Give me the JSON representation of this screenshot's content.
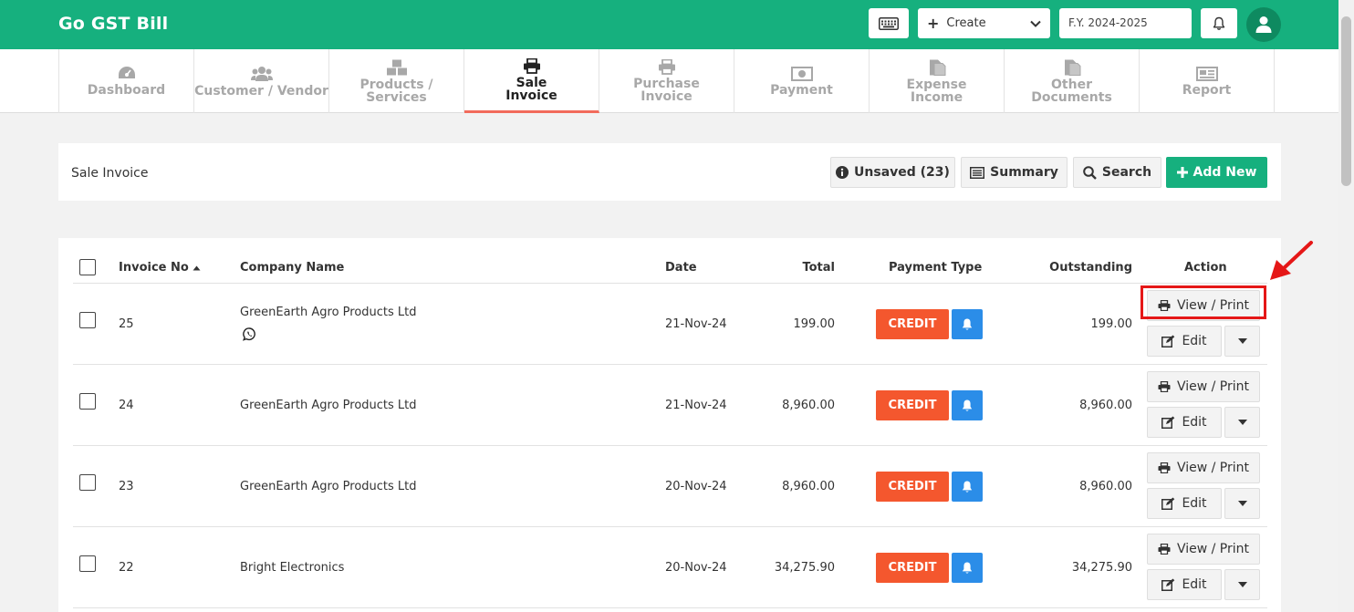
{
  "app": {
    "title": "Go GST Bill"
  },
  "topbar": {
    "keyboard_icon": "keyboard-icon",
    "create_label": "Create",
    "fy_value": "F.Y. 2024-2025",
    "notifications_icon": "bell-icon",
    "user_icon": "user-icon"
  },
  "nav": {
    "tabs": [
      {
        "label": "Dashboard",
        "icon": "dashboard-icon"
      },
      {
        "label": "Customer / Vendor",
        "icon": "users-icon"
      },
      {
        "label": "Products / Services",
        "icon": "cubes-icon"
      },
      {
        "label": "Sale\nInvoice",
        "icon": "printer-icon",
        "active": true
      },
      {
        "label": "Purchase\nInvoice",
        "icon": "printer-icon"
      },
      {
        "label": "Payment",
        "icon": "money-icon"
      },
      {
        "label": "Expense\nIncome",
        "icon": "file-icon"
      },
      {
        "label": "Other\nDocuments",
        "icon": "file-icon"
      },
      {
        "label": "Report",
        "icon": "newspaper-icon"
      }
    ]
  },
  "page": {
    "title": "Sale Invoice",
    "unsaved_label": "Unsaved (23)",
    "summary_label": "Summary",
    "search_label": "Search",
    "add_new_label": "Add New"
  },
  "table": {
    "headers": {
      "invoice_no": "Invoice No",
      "company": "Company Name",
      "date": "Date",
      "total": "Total",
      "payment_type": "Payment Type",
      "outstanding": "Outstanding",
      "action": "Action"
    },
    "rows": [
      {
        "invoice_no": "25",
        "company": "GreenEarth Agro Products Ltd",
        "date": "21-Nov-24",
        "total": "199.00",
        "payment_type": "CREDIT",
        "outstanding": "199.00",
        "has_whatsapp": true
      },
      {
        "invoice_no": "24",
        "company": "GreenEarth Agro Products Ltd",
        "date": "21-Nov-24",
        "total": "8,960.00",
        "payment_type": "CREDIT",
        "outstanding": "8,960.00"
      },
      {
        "invoice_no": "23",
        "company": "GreenEarth Agro Products Ltd",
        "date": "20-Nov-24",
        "total": "8,960.00",
        "payment_type": "CREDIT",
        "outstanding": "8,960.00"
      },
      {
        "invoice_no": "22",
        "company": "Bright Electronics",
        "date": "20-Nov-24",
        "total": "34,275.90",
        "payment_type": "CREDIT",
        "outstanding": "34,275.90"
      }
    ],
    "view_print_label": "View / Print",
    "edit_label": "Edit"
  },
  "colors": {
    "brand": "#16b07e",
    "credit": "#f4572e",
    "notify": "#2b8de8",
    "active_tab_underline": "#f26b5b",
    "highlight": "#e51717"
  }
}
